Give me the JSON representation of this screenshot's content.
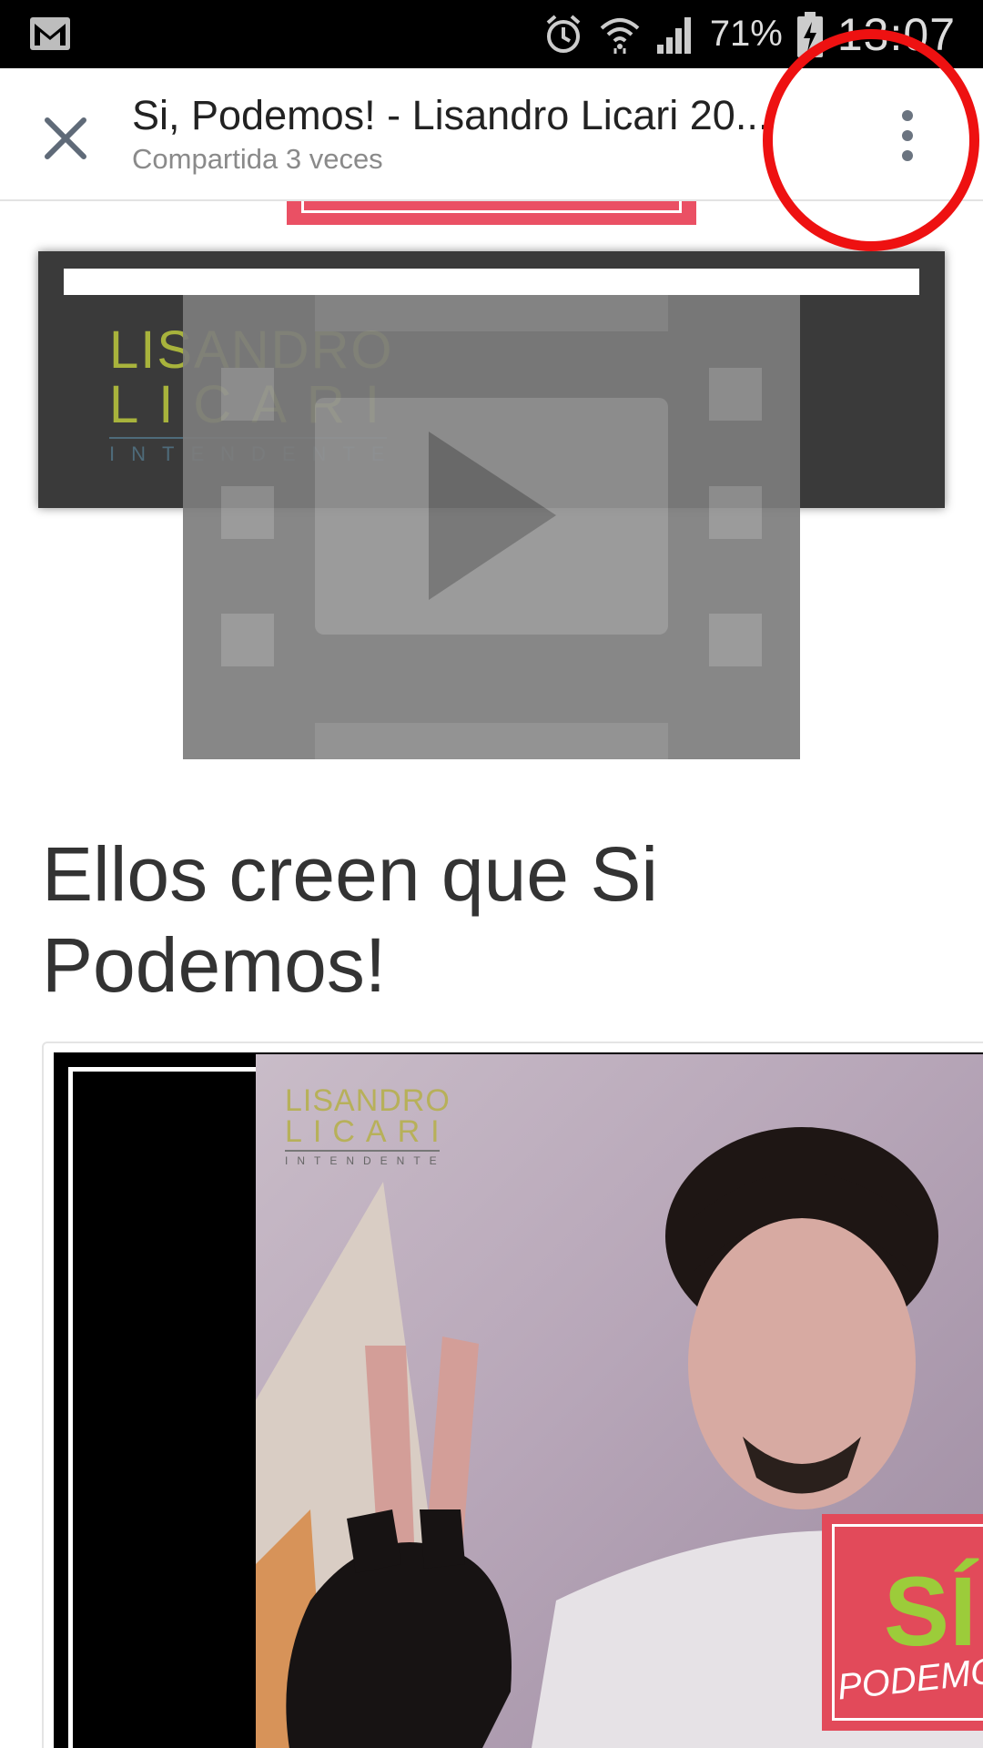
{
  "status_bar": {
    "battery_percent": "71%",
    "time": "13:07",
    "icons": [
      "gmail-icon",
      "alarm-icon",
      "wifi-icon",
      "signal-icon",
      "battery-charging-icon"
    ]
  },
  "header": {
    "title": "Si, Podemos! - Lisandro Licari 20...",
    "subtitle": "Compartida 3 veces",
    "close_icon": "close-icon",
    "more_icon": "more-vert-icon"
  },
  "banner_logo": {
    "line1": "LISANDRO",
    "line2": "LICARI",
    "line3": "INTENDENTE"
  },
  "video_placeholder_icon": "video-play-icon",
  "heading": "Ellos creen que Si Podemos!",
  "photo_logo": {
    "line1": "LISANDRO",
    "line2": "LICARI",
    "line3": "INTENDENTE"
  },
  "badge": {
    "si": "SÍ",
    "podemos": "PODEMOS"
  },
  "colors": {
    "annotation_circle": "#ee1111",
    "badge_red": "#e24a5a",
    "logo_olive": "#a8b33c",
    "badge_green": "#9ccc3a"
  }
}
